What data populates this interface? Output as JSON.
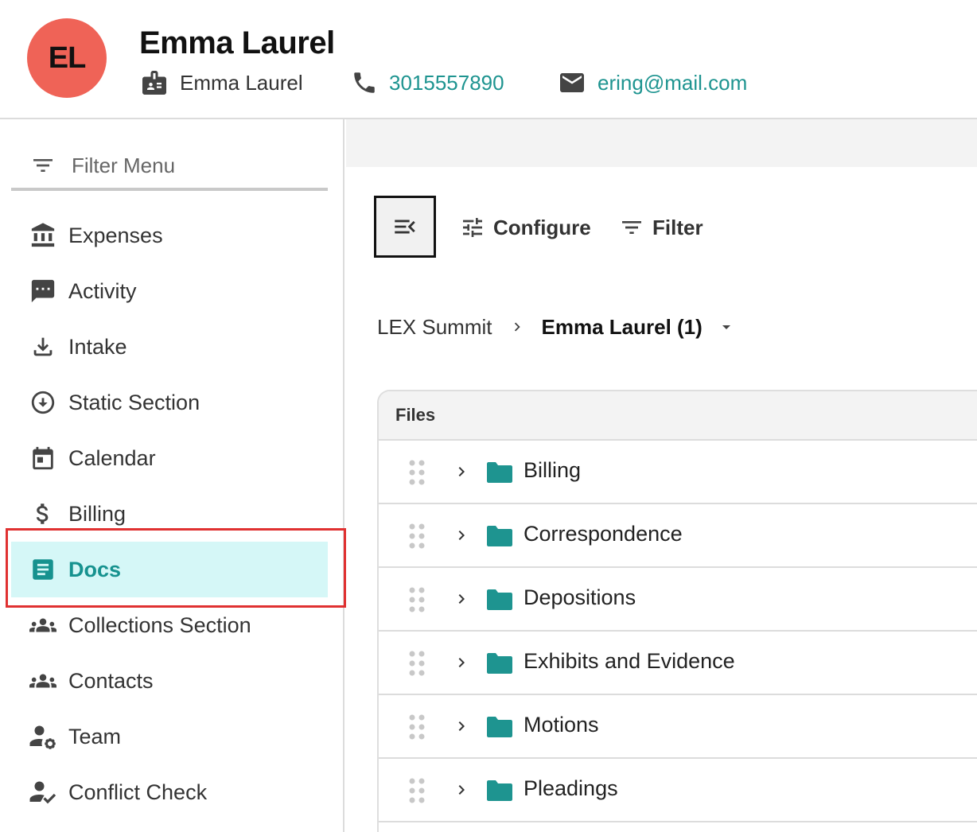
{
  "header": {
    "initials": "EL",
    "name": "Emma Laurel",
    "contact_name": "Emma Laurel",
    "phone": "3015557890",
    "email": "ering@mail.com"
  },
  "sidebar": {
    "filter_label": "Filter Menu",
    "items": [
      {
        "label": "Expenses",
        "icon": "bank-icon"
      },
      {
        "label": "Activity",
        "icon": "chat-icon"
      },
      {
        "label": "Intake",
        "icon": "download-icon"
      },
      {
        "label": "Static Section",
        "icon": "circle-arrow-down-icon"
      },
      {
        "label": "Calendar",
        "icon": "calendar-icon"
      },
      {
        "label": "Billing",
        "icon": "dollar-icon"
      },
      {
        "label": "Docs",
        "icon": "document-icon",
        "active": true
      },
      {
        "label": "Collections Section",
        "icon": "group-icon"
      },
      {
        "label": "Contacts",
        "icon": "group-icon"
      },
      {
        "label": "Team",
        "icon": "user-gear-icon"
      },
      {
        "label": "Conflict Check",
        "icon": "user-check-icon"
      }
    ]
  },
  "toolbar": {
    "configure_label": "Configure",
    "filter_label": "Filter"
  },
  "breadcrumb": {
    "parent": "LEX Summit",
    "current": "Emma Laurel (1)"
  },
  "files": {
    "header": "Files",
    "folders": [
      "Billing",
      "Correspondence",
      "Depositions",
      "Exhibits and Evidence",
      "Motions",
      "Pleadings"
    ]
  },
  "colors": {
    "accent": "#1e9490",
    "active_bg": "#d5f7f7",
    "avatar": "#ef6357",
    "highlight": "#e03131"
  }
}
